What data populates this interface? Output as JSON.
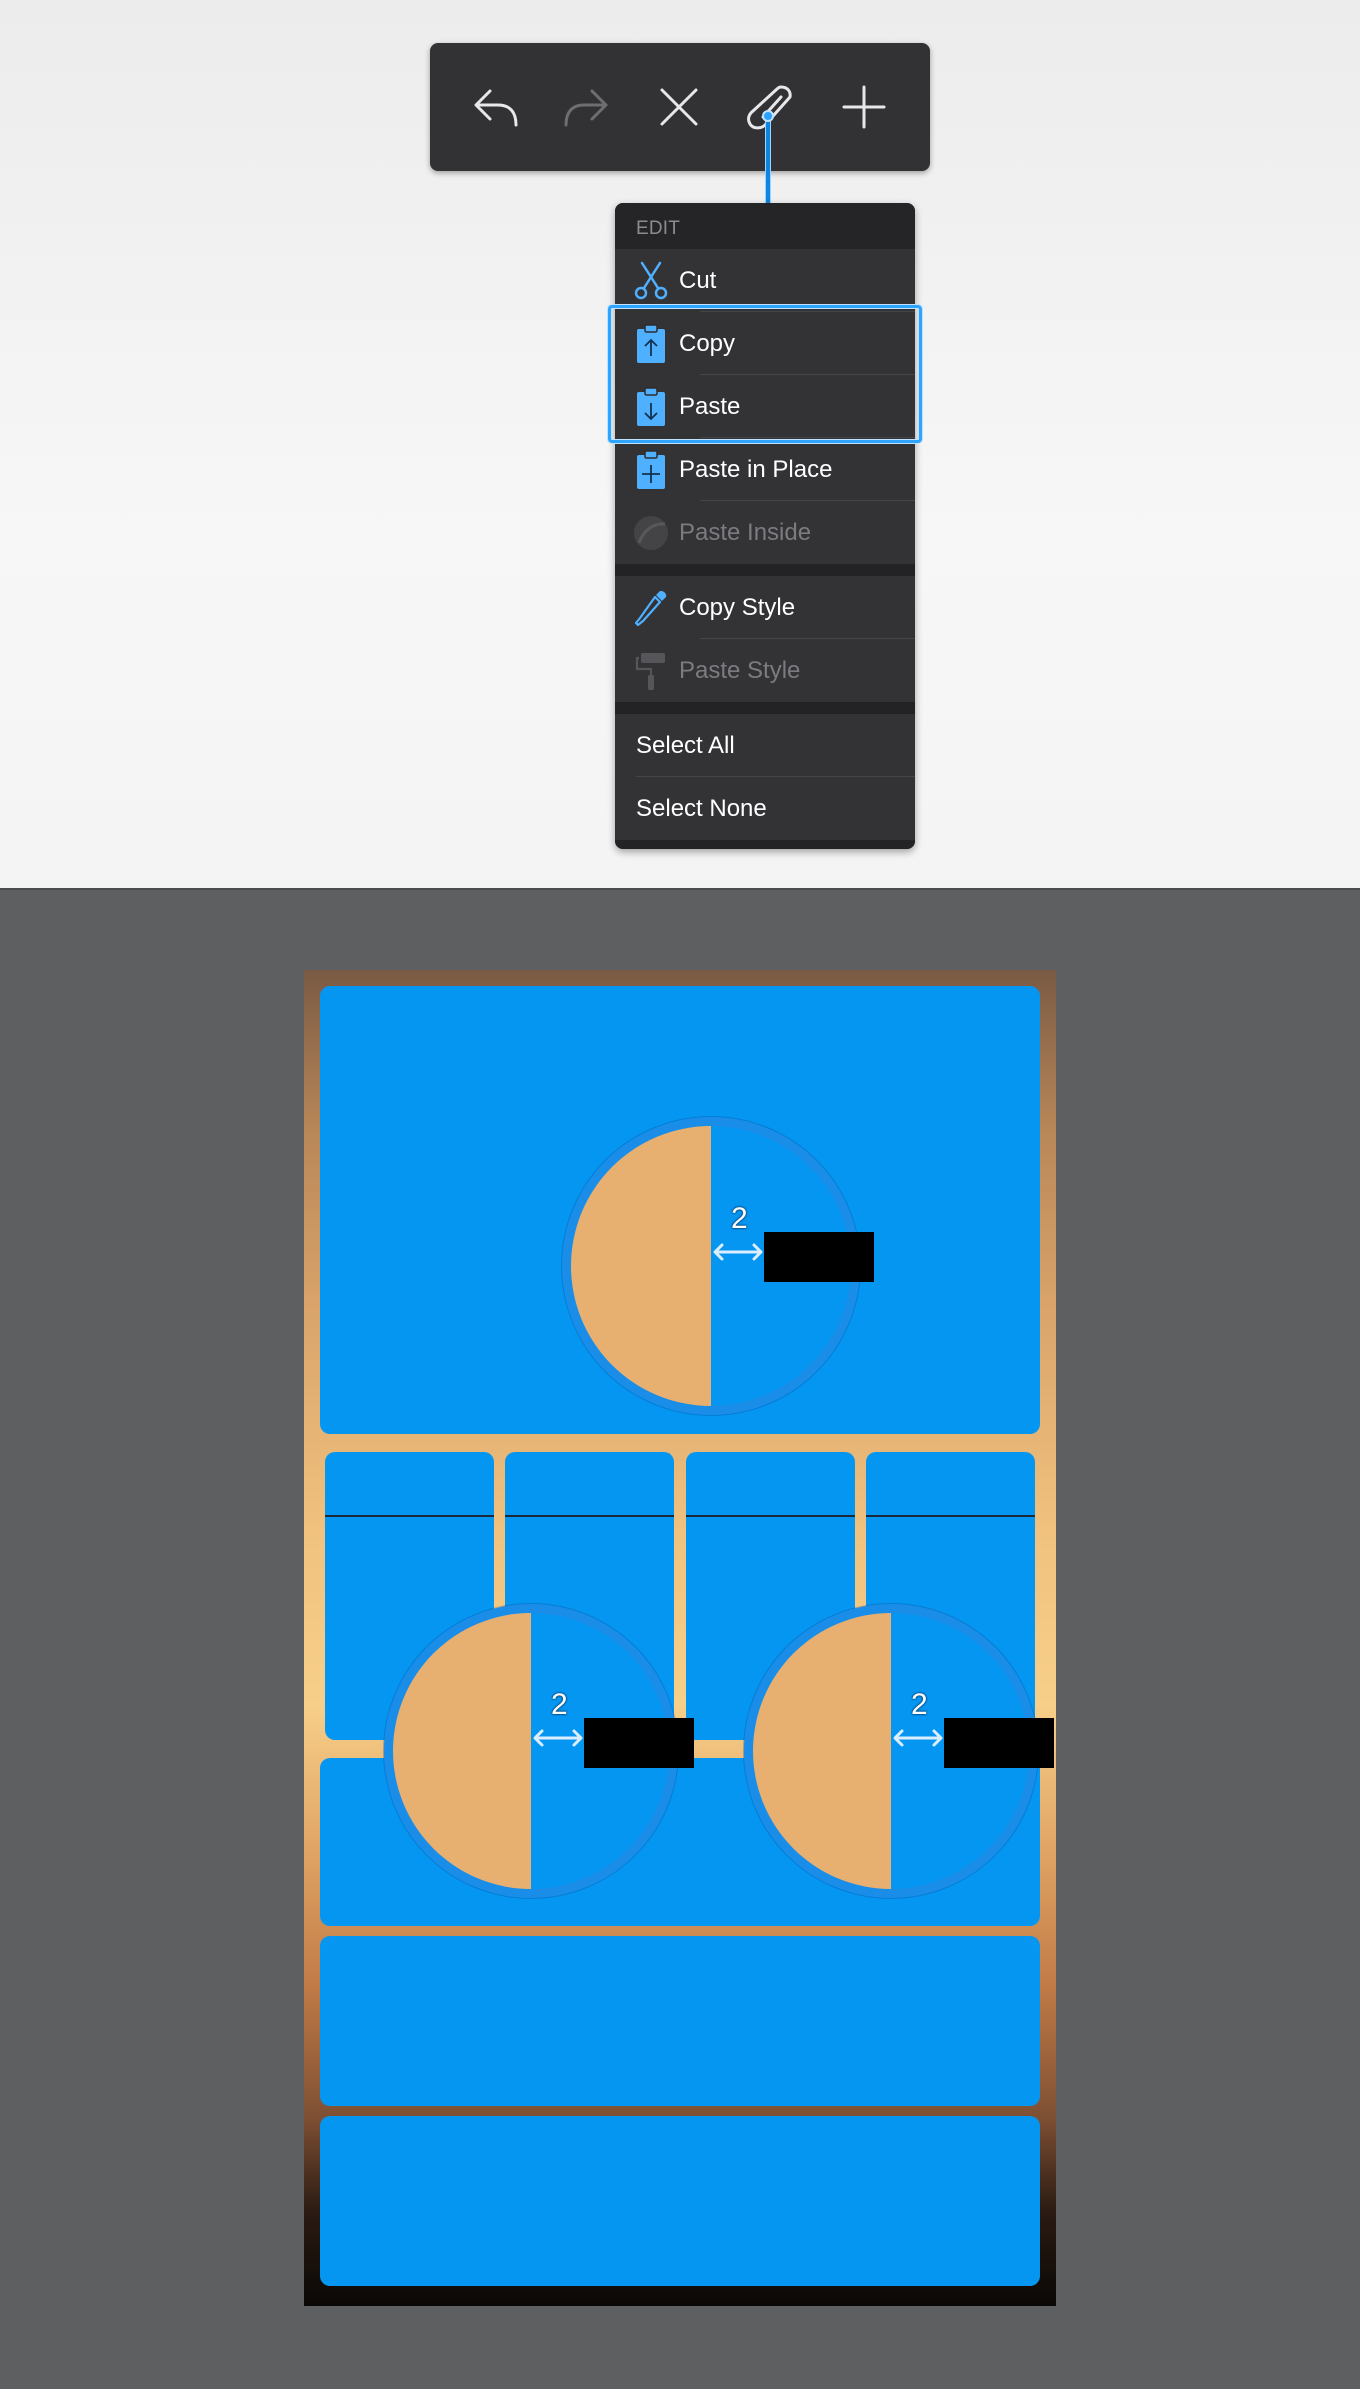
{
  "toolbar": {
    "buttons": [
      {
        "name": "undo-button",
        "icon": "undo-icon"
      },
      {
        "name": "redo-button",
        "icon": "redo-icon",
        "disabled": true
      },
      {
        "name": "delete-button",
        "icon": "close-icon"
      },
      {
        "name": "tools-button",
        "icon": "wrench-icon",
        "active": true
      },
      {
        "name": "add-button",
        "icon": "plus-icon"
      }
    ]
  },
  "menu": {
    "header": "EDIT",
    "items": {
      "cut": {
        "label": "Cut",
        "icon": "scissors-icon"
      },
      "copy": {
        "label": "Copy",
        "icon": "clipboard-copy-icon"
      },
      "paste": {
        "label": "Paste",
        "icon": "clipboard-paste-icon"
      },
      "paste_in_place": {
        "label": "Paste in Place",
        "icon": "clipboard-add-icon"
      },
      "paste_inside": {
        "label": "Paste Inside",
        "icon": "paste-inside-icon",
        "disabled": true
      },
      "copy_style": {
        "label": "Copy Style",
        "icon": "eyedropper-icon"
      },
      "paste_style": {
        "label": "Paste Style",
        "icon": "paint-roller-icon",
        "disabled": true
      },
      "select_all": {
        "label": "Select All"
      },
      "select_none": {
        "label": "Select None"
      }
    },
    "highlighted": [
      "Copy",
      "Paste"
    ]
  },
  "canvas": {
    "measurements": {
      "top": "2",
      "bottom_left": "2",
      "bottom_right": "2"
    }
  },
  "colors": {
    "accent": "#0596f2",
    "toolbar_bg": "#323235",
    "menu_bg": "#2c2c2e",
    "highlight": "#2ea4ff",
    "canvas_bg": "#5e5f61",
    "circle_fill": "#e8b070"
  }
}
